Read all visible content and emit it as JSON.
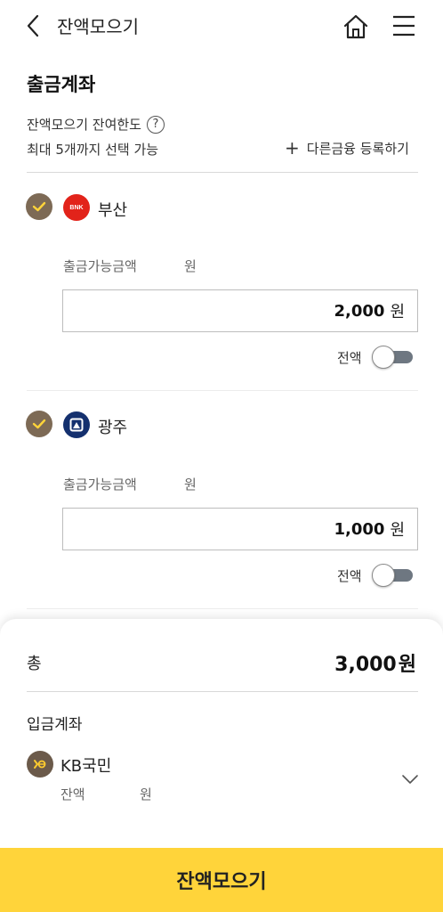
{
  "header": {
    "title": "잔액모으기",
    "back_icon": "chevron-left-icon",
    "home_icon": "home-icon",
    "menu_icon": "menu-icon"
  },
  "withdraw": {
    "title": "출금계좌",
    "limit_label": "잔액모으기 잔여한도",
    "limit_help": "?",
    "max_note": "최대 5개까지 선택 가능",
    "register_plus": "+",
    "register_label": "다른금융 등록하기",
    "accounts": [
      {
        "bank": "부산",
        "logo_text": "BNK",
        "logo_color": "#e2231a",
        "available_label": "출금가능금액",
        "available_unit": "원",
        "amount": "2,000",
        "amount_unit": "원",
        "all_label": "전액",
        "all_on": false,
        "checked": true
      },
      {
        "bank": "광주",
        "logo_color": "#14306e",
        "available_label": "출금가능금액",
        "available_unit": "원",
        "amount": "1,000",
        "amount_unit": "원",
        "all_label": "전액",
        "all_on": false,
        "checked": true
      }
    ]
  },
  "summary": {
    "total_label": "총",
    "total_value": "3,000",
    "total_unit": "원"
  },
  "deposit": {
    "title": "입금계좌",
    "bank": "KB국민",
    "logo_color": "#6b5a4a",
    "balance_label": "잔액",
    "balance_unit": "원",
    "dropdown_icon": "chevron-down-icon"
  },
  "cta": {
    "label": "잔액모으기",
    "color": "#ffd43a"
  },
  "colors": {
    "check_bg": "#7d6a55",
    "check_mark": "#ffd43a",
    "toggle_track": "#6e7781"
  }
}
